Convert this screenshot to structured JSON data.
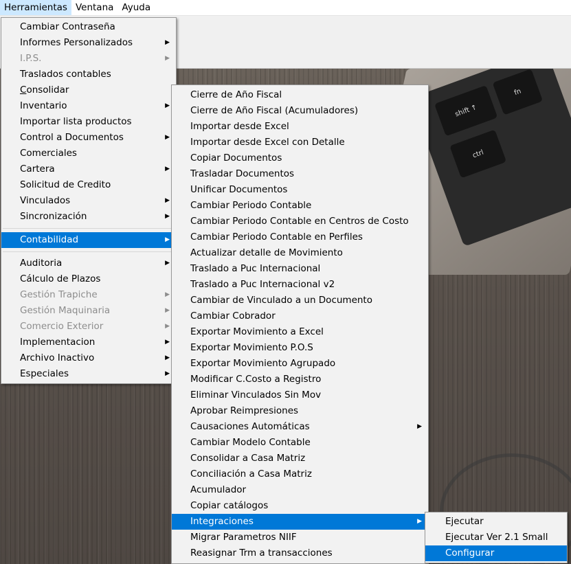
{
  "menubar": {
    "items": [
      {
        "label": "Herramientas"
      },
      {
        "label": "Ventana"
      },
      {
        "label": "Ayuda"
      }
    ]
  },
  "icons": {
    "submenu": "triangle-right-icon"
  },
  "laptop_keys": {
    "shift": "shift ↑",
    "fn": "fn",
    "ctrl": "ctrl"
  },
  "colors": {
    "highlight": "#0078d7",
    "menu_bg": "#f2f2f2",
    "disabled": "#8d8d8d"
  },
  "herramientas_menu": {
    "group1": [
      {
        "label": "Cambiar Contraseña",
        "submenu": false,
        "disabled": false
      },
      {
        "label": "Informes Personalizados",
        "submenu": true,
        "disabled": false
      },
      {
        "label": "I.P.S.",
        "submenu": true,
        "disabled": true
      },
      {
        "label": "Traslados contables",
        "submenu": false,
        "disabled": false
      },
      {
        "label": "Consolidar",
        "submenu": false,
        "disabled": false
      },
      {
        "label": "Inventario",
        "submenu": true,
        "disabled": false
      },
      {
        "label": "Importar lista productos",
        "submenu": false,
        "disabled": false
      },
      {
        "label": "Control a Documentos",
        "submenu": true,
        "disabled": false
      },
      {
        "label": "Comerciales",
        "submenu": false,
        "disabled": false
      },
      {
        "label": "Cartera",
        "submenu": true,
        "disabled": false
      },
      {
        "label": "Solicitud de Credito",
        "submenu": false,
        "disabled": false
      },
      {
        "label": "Vinculados",
        "submenu": true,
        "disabled": false
      },
      {
        "label": "Sincronización",
        "submenu": true,
        "disabled": false
      }
    ],
    "group2": [
      {
        "label": "Contabilidad",
        "submenu": true,
        "disabled": false,
        "highlighted": true
      }
    ],
    "group3": [
      {
        "label": "Auditoria",
        "submenu": true,
        "disabled": false
      },
      {
        "label": "Cálculo de Plazos",
        "submenu": false,
        "disabled": false
      },
      {
        "label": "Gestión Trapiche",
        "submenu": true,
        "disabled": true
      },
      {
        "label": "Gestión Maquinaria",
        "submenu": true,
        "disabled": true
      },
      {
        "label": "Comercio Exterior",
        "submenu": true,
        "disabled": true
      },
      {
        "label": "Implementacion",
        "submenu": true,
        "disabled": false
      },
      {
        "label": "Archivo Inactivo",
        "submenu": true,
        "disabled": false
      },
      {
        "label": "Especiales",
        "submenu": true,
        "disabled": false
      }
    ]
  },
  "contabilidad_menu": {
    "items": [
      {
        "label": "Cierre de Año Fiscal",
        "submenu": false
      },
      {
        "label": "Cierre de Año Fiscal (Acumuladores)",
        "submenu": false
      },
      {
        "label": "Importar desde Excel",
        "submenu": false
      },
      {
        "label": "Importar desde Excel con Detalle",
        "submenu": false
      },
      {
        "label": "Copiar Documentos",
        "submenu": false
      },
      {
        "label": "Trasladar Documentos",
        "submenu": false
      },
      {
        "label": "Unificar Documentos",
        "submenu": false
      },
      {
        "label": "Cambiar Periodo Contable",
        "submenu": false
      },
      {
        "label": "Cambiar Periodo Contable en Centros de Costo",
        "submenu": false
      },
      {
        "label": "Cambiar Periodo Contable en Perfiles",
        "submenu": false
      },
      {
        "label": "Actualizar detalle de Movimiento",
        "submenu": false
      },
      {
        "label": "Traslado a Puc Internacional",
        "submenu": false
      },
      {
        "label": "Traslado a Puc Internacional v2",
        "submenu": false
      },
      {
        "label": "Cambiar de Vinculado a un Documento",
        "submenu": false
      },
      {
        "label": "Cambiar Cobrador",
        "submenu": false
      },
      {
        "label": "Exportar Movimiento a Excel",
        "submenu": false
      },
      {
        "label": "Exportar Movimiento P.O.S",
        "submenu": false
      },
      {
        "label": "Exportar Movimiento Agrupado",
        "submenu": false
      },
      {
        "label": "Modificar C.Costo a Registro",
        "submenu": false
      },
      {
        "label": "Eliminar Vinculados Sin Mov",
        "submenu": false
      },
      {
        "label": "Aprobar Reimpresiones",
        "submenu": false
      },
      {
        "label": "Causaciones Automáticas",
        "submenu": true
      },
      {
        "label": "Cambiar Modelo Contable",
        "submenu": false
      },
      {
        "label": "Consolidar a Casa Matriz",
        "submenu": false
      },
      {
        "label": "Conciliación a Casa Matriz",
        "submenu": false
      },
      {
        "label": "Acumulador",
        "submenu": false
      },
      {
        "label": "Copiar catálogos",
        "submenu": false
      },
      {
        "label": "Integraciones",
        "submenu": true,
        "highlighted": true
      },
      {
        "label": "Migrar Parametros NIIF",
        "submenu": false
      },
      {
        "label": "Reasignar Trm a transacciones",
        "submenu": false
      }
    ]
  },
  "integraciones_menu": {
    "items": [
      {
        "label": "Ejecutar"
      },
      {
        "label": "Ejecutar Ver 2.1 Small"
      },
      {
        "label": "Configurar",
        "highlighted": true
      }
    ]
  }
}
